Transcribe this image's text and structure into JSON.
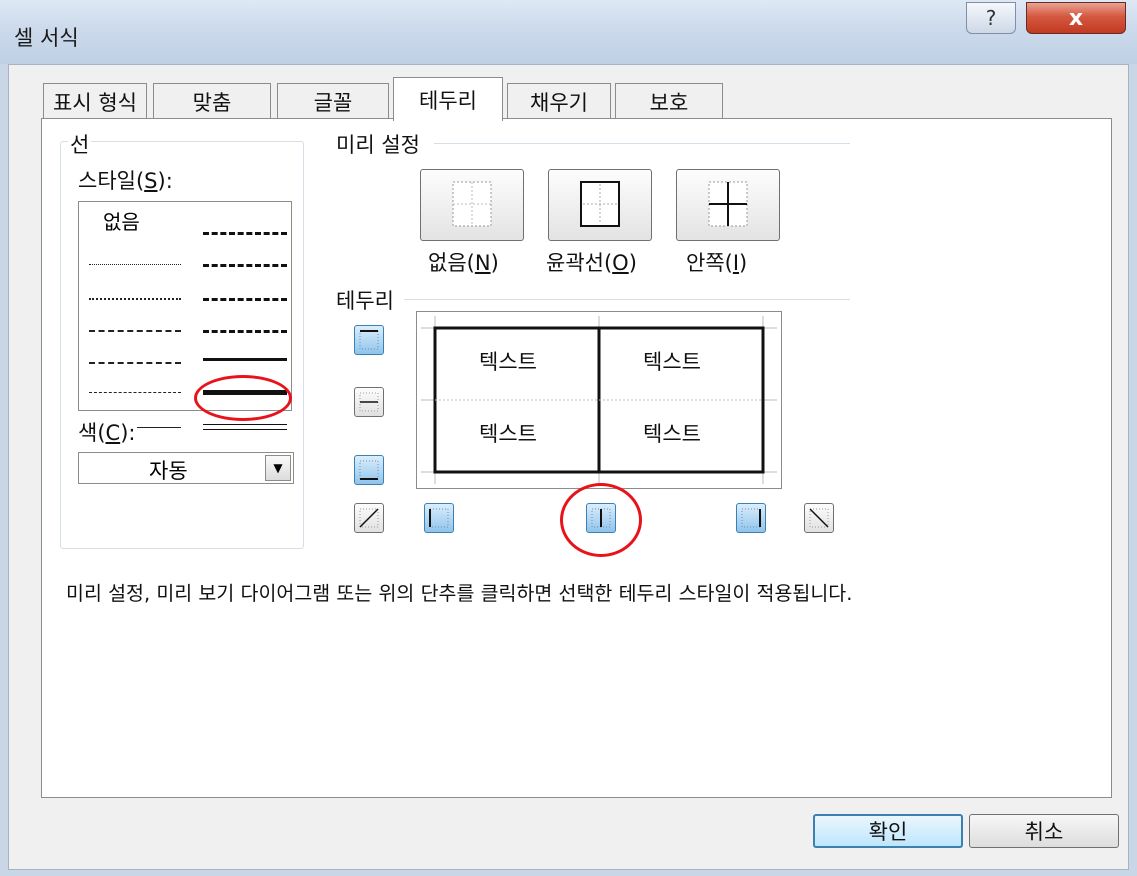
{
  "window": {
    "title": "셀 서식",
    "help_glyph": "?",
    "close_glyph": "x"
  },
  "tabs": [
    {
      "label": "표시 형식"
    },
    {
      "label": "맞춤"
    },
    {
      "label": "글꼴"
    },
    {
      "label": "테두리",
      "active": true
    },
    {
      "label": "채우기"
    },
    {
      "label": "보호"
    }
  ],
  "line_group": {
    "label": "선",
    "style_label": "스타일(S):",
    "style_none_label": "없음",
    "color_label": "색(C):",
    "color_value": "자동"
  },
  "presets": {
    "label": "미리 설정",
    "items": [
      {
        "label": "없음(N)"
      },
      {
        "label": "윤곽선(O)"
      },
      {
        "label": "안쪽(I)"
      }
    ]
  },
  "border": {
    "label": "테두리",
    "cells": [
      "텍스트",
      "텍스트",
      "텍스트",
      "텍스트"
    ]
  },
  "hint": "미리 설정, 미리 보기 다이어그램 또는 위의 단추를 클릭하면 선택한 테두리 스타일이 적용됩니다.",
  "buttons": {
    "ok": "확인",
    "cancel": "취소"
  },
  "colors": {
    "annotation_red": "#e8131a",
    "toggle_on": "#8fc4ec"
  },
  "icons": {
    "help": "help-icon",
    "close": "close-icon",
    "dropdown": "chevron-down-icon"
  }
}
